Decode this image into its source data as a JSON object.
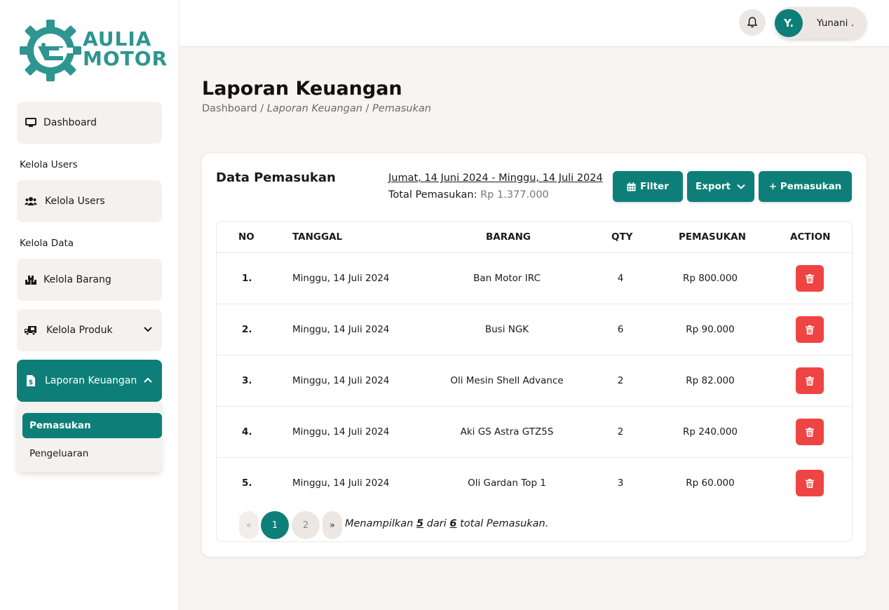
{
  "brand": {
    "line1": "AULIA",
    "line2": "MOTOR",
    "color": "#2e9590"
  },
  "sidebar": {
    "items": [
      {
        "label": "Dashboard",
        "icon": "monitor-icon"
      },
      {
        "label": "Kelola Users",
        "icon": "users-icon"
      },
      {
        "label": "Kelola Barang",
        "icon": "boxes-icon"
      },
      {
        "label": "Kelola Produk",
        "icon": "truck-icon"
      },
      {
        "label": "Laporan Keuangan",
        "icon": "file-invoice-dollar-icon"
      }
    ],
    "sections": [
      "Kelola Users",
      "Kelola Data"
    ],
    "submenu": [
      "Pemasukan",
      "Pengeluaran"
    ]
  },
  "topbar": {
    "avatar_initial": "Y.",
    "user_name": "Yunani ."
  },
  "page": {
    "title": "Laporan Keuangan",
    "breadcrumb": {
      "root": "Dashboard",
      "sep": " / ",
      "level1": "Laporan Keuangan",
      "level2": "Pemasukan"
    }
  },
  "card": {
    "title": "Data Pemasukan",
    "date_range": "Jumat, 14 Juni 2024 - Minggu, 14 Juli 2024",
    "total_label": "Total Pemasukan:",
    "total_value": "Rp 1.377.000",
    "buttons": {
      "filter": "Filter",
      "export": "Export",
      "add": "+ Pemasukan"
    }
  },
  "table": {
    "headers": [
      "NO",
      "TANGGAL",
      "BARANG",
      "QTY",
      "PEMASUKAN",
      "ACTION"
    ],
    "rows": [
      {
        "no": "1.",
        "tanggal": "Minggu, 14 Juli 2024",
        "barang": "Ban Motor IRC",
        "qty": "4",
        "pemasukan": "Rp 800.000"
      },
      {
        "no": "2.",
        "tanggal": "Minggu, 14 Juli 2024",
        "barang": "Busi NGK",
        "qty": "6",
        "pemasukan": "Rp 90.000"
      },
      {
        "no": "3.",
        "tanggal": "Minggu, 14 Juli 2024",
        "barang": "Oli Mesin Shell Advance",
        "qty": "2",
        "pemasukan": "Rp 82.000"
      },
      {
        "no": "4.",
        "tanggal": "Minggu, 14 Juli 2024",
        "barang": "Aki GS Astra GTZ5S",
        "qty": "2",
        "pemasukan": "Rp 240.000"
      },
      {
        "no": "5.",
        "tanggal": "Minggu, 14 Juli 2024",
        "barang": "Oli Gardan Top 1",
        "qty": "3",
        "pemasukan": "Rp 60.000"
      }
    ]
  },
  "pagination": {
    "prev": "«",
    "pages": [
      "1",
      "2"
    ],
    "next": "»",
    "info_pre": "Menampilkan ",
    "shown": "5",
    "info_mid": " dari ",
    "total": "6",
    "info_post": " total Pemasukan."
  },
  "colors": {
    "primary": "#0d7f78",
    "danger": "#ef4444"
  }
}
